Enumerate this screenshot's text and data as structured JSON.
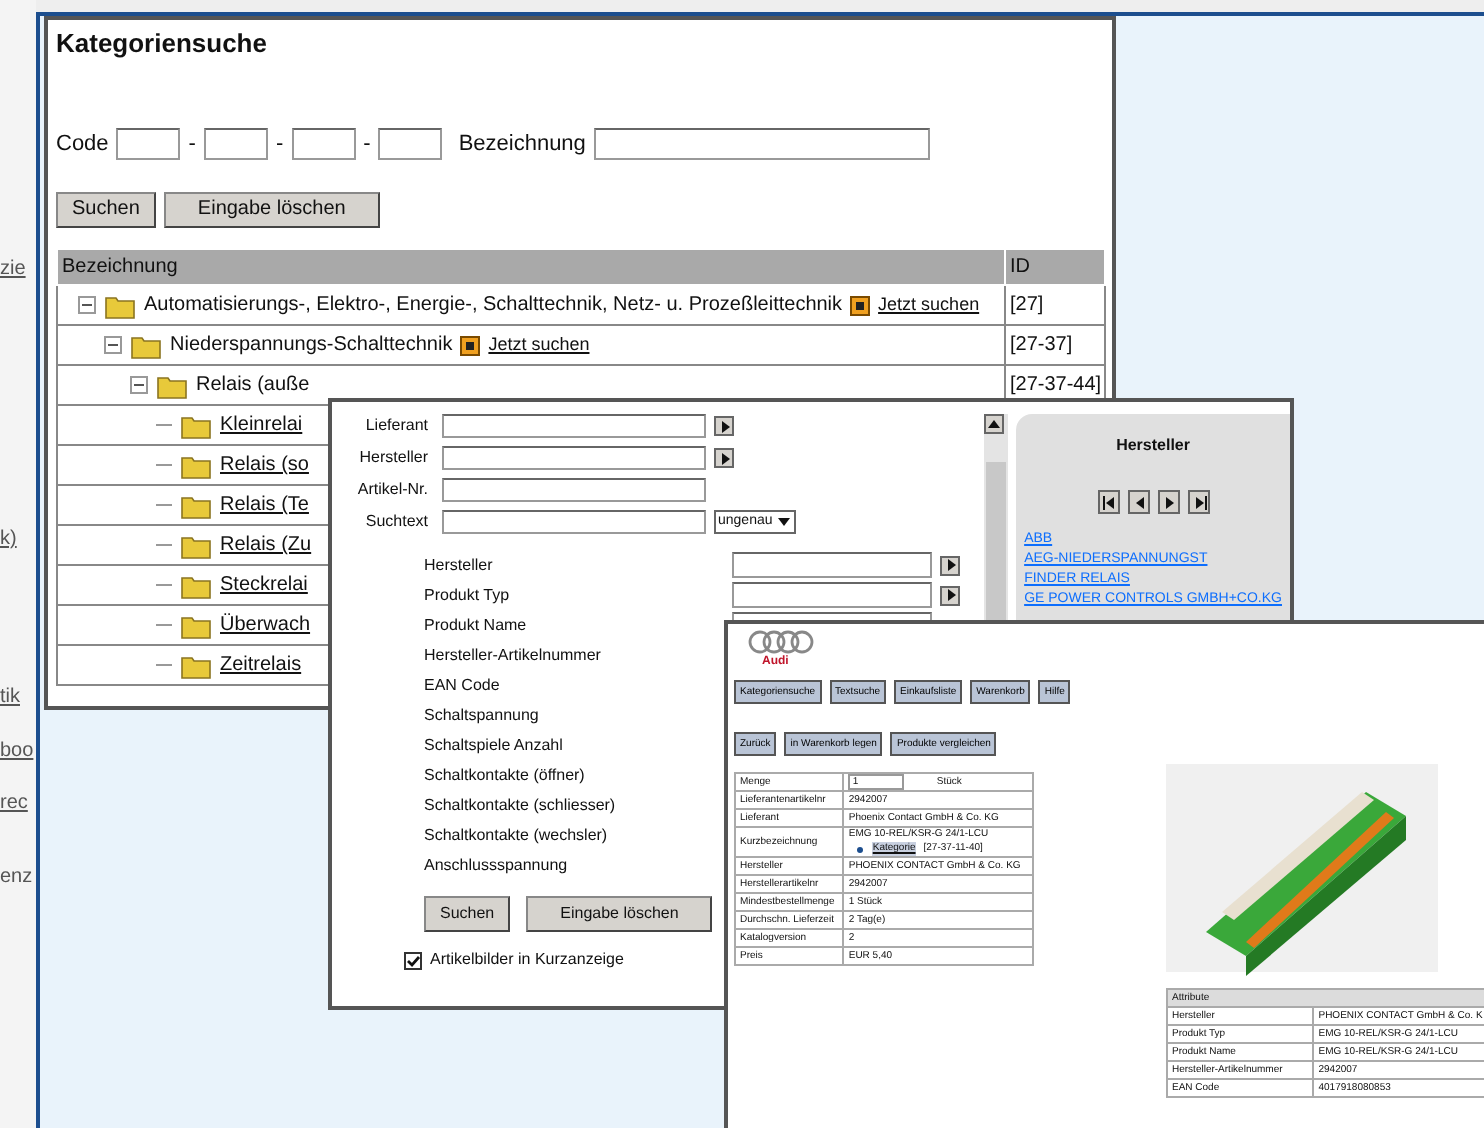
{
  "background_page": {
    "fragments": [
      {
        "text": "zie",
        "link": true
      },
      {
        "text": "k)",
        "link": true
      },
      {
        "text": "tik",
        "link": true
      },
      {
        "text": "boo",
        "link": true
      },
      {
        "text": "rec",
        "link": true
      },
      {
        "text": "enz",
        "link": false
      }
    ]
  },
  "category_search": {
    "title": "Kategoriensuche",
    "code_label": "Code",
    "separator": "-",
    "name_label": "Bezeichnung",
    "buttons": [
      "Suchen",
      "Eingabe löschen"
    ],
    "columns": [
      "Bezeichnung",
      "ID"
    ],
    "tree": [
      {
        "kind": "branch",
        "expanded": true,
        "label": "Automatisierungs-, Elektro-, Energie-, Schalttechnik, Netz- u. Prozeßleittechnik",
        "link": "Jetzt suchen",
        "id": "[27]",
        "children": [
          {
            "kind": "branch",
            "expanded": true,
            "label": "Niederspannungs-Schalttechnik",
            "link": "Jetzt suchen",
            "id": "[27-37]",
            "children": [
              {
                "kind": "branch",
                "expanded": true,
                "label": "Relais (auße",
                "id": "[27-37-44]",
                "children": [
                  {
                    "kind": "leaf",
                    "label": "Kleinrelai"
                  },
                  {
                    "kind": "leaf",
                    "label": "Relais (so"
                  },
                  {
                    "kind": "leaf",
                    "label": "Relais (Te"
                  },
                  {
                    "kind": "leaf",
                    "label": "Relais (Zu"
                  },
                  {
                    "kind": "leaf",
                    "label": "Steckrelai"
                  },
                  {
                    "kind": "leaf",
                    "label": "Überwach"
                  },
                  {
                    "kind": "leaf",
                    "label": "Zeitrelais"
                  }
                ]
              }
            ]
          }
        ]
      }
    ]
  },
  "text_search": {
    "fields": [
      {
        "label": "Lieferant",
        "picker": true
      },
      {
        "label": "Hersteller",
        "picker": true
      },
      {
        "label": "Artikel-Nr.",
        "picker": false
      },
      {
        "label": "Suchtext",
        "picker": false,
        "mode": "ungenau"
      }
    ],
    "attributes": [
      {
        "label": "Hersteller",
        "picker": true
      },
      {
        "label": "Produkt Typ",
        "picker": true
      },
      {
        "label": "Produkt Name",
        "picker": false
      },
      {
        "label": "Hersteller-Artikelnummer",
        "picker": false
      },
      {
        "label": "EAN Code",
        "picker": false
      },
      {
        "label": "Schaltspannung",
        "picker": false
      },
      {
        "label": "Schaltspiele Anzahl",
        "picker": false
      },
      {
        "label": "Schaltkontakte (öffner)",
        "picker": false
      },
      {
        "label": "Schaltkontakte (schliesser)",
        "picker": false
      },
      {
        "label": "Schaltkontakte (wechsler)",
        "picker": false
      },
      {
        "label": "Anschlussspannung",
        "picker": false
      }
    ],
    "buttons": [
      "Suchen",
      "Eingabe löschen"
    ],
    "option": {
      "label": "Artikelbilder in Kurzanzeige",
      "checked": true
    },
    "manufacturer_panel": {
      "title": "Hersteller",
      "links": [
        "ABB",
        "AEG-NIEDERSPANNUNGST",
        "FINDER RELAIS",
        "GE POWER CONTROLS GMBH+CO.KG"
      ]
    }
  },
  "product_detail": {
    "brand": "Audi",
    "nav": [
      "Kategoriensuche",
      "Textsuche",
      "Einkaufsliste",
      "Warenkorb",
      "Hilfe"
    ],
    "actions": [
      "Zurück",
      "in Warenkorb legen",
      "Produkte vergleichen"
    ],
    "details": [
      {
        "kind": "quantity",
        "label": "Menge",
        "value": "1",
        "unit": "Stück"
      },
      {
        "kind": "text",
        "label": "Lieferantenartikelnr",
        "value": "2942007"
      },
      {
        "kind": "text",
        "label": "Lieferant",
        "value": "Phoenix Contact GmbH & Co. KG"
      },
      {
        "kind": "category",
        "label": "Kurzbezeichnung",
        "value": "EMG 10-REL/KSR-G 24/1-LCU",
        "link": "Kategorie",
        "code": "[27-37-11-40]"
      },
      {
        "kind": "text",
        "label": "Hersteller",
        "value": "PHOENIX CONTACT GmbH & Co. KG"
      },
      {
        "kind": "text",
        "label": "Herstellerartikelnr",
        "value": "2942007"
      },
      {
        "kind": "text",
        "label": "Mindestbestellmenge",
        "value": "1 Stück"
      },
      {
        "kind": "text",
        "label": "Durchschn. Lieferzeit",
        "value": "2 Tag(e)"
      },
      {
        "kind": "text",
        "label": "Katalogversion",
        "value": "2"
      },
      {
        "kind": "text",
        "label": "Preis",
        "value": "EUR 5,40"
      }
    ],
    "attributes_title": "Attribute",
    "attributes": [
      {
        "label": "Hersteller",
        "value": "PHOENIX CONTACT GmbH & Co. K"
      },
      {
        "label": "Produkt Typ",
        "value": "EMG 10-REL/KSR-G 24/1-LCU"
      },
      {
        "label": "Produkt Name",
        "value": "EMG 10-REL/KSR-G 24/1-LCU"
      },
      {
        "label": "Hersteller-Artikelnummer",
        "value": "2942007"
      },
      {
        "label": "EAN Code",
        "value": "4017918080853"
      }
    ]
  }
}
